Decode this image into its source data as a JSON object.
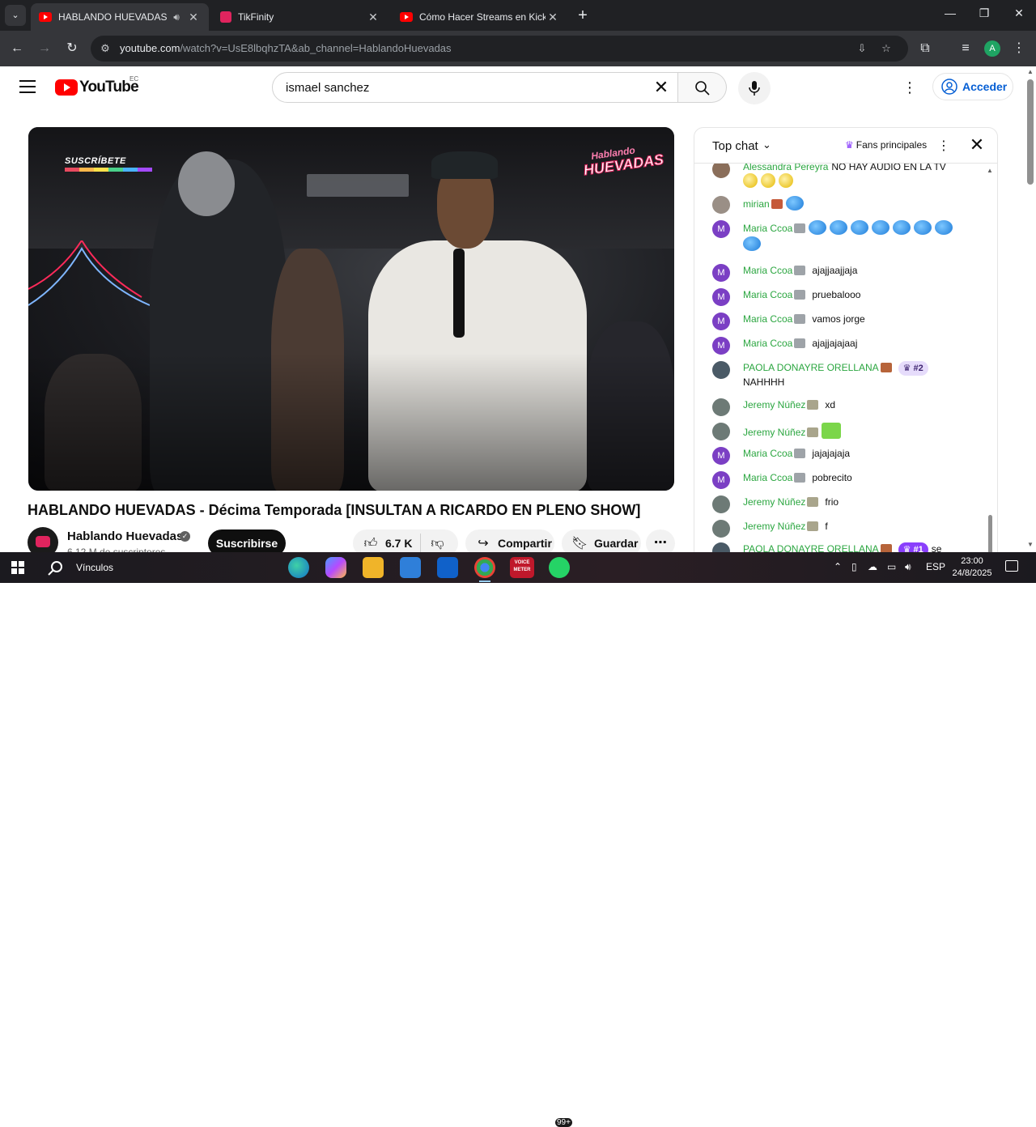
{
  "browser": {
    "tabs": [
      {
        "title": "HABLANDO HUEVADAS - D",
        "icon": "youtube-icon",
        "active": true,
        "audio": true
      },
      {
        "title": "TikFinity",
        "icon": "tikfinity-icon",
        "active": false
      },
      {
        "title": "Cómo Hacer Streams en Kick (C",
        "icon": "youtube-icon",
        "active": false
      }
    ],
    "url_host": "youtube.com",
    "url_path": "/watch?v=UsE8lbqhzTA&ab_channel=HablandoHuevadas",
    "profile_initial": "A"
  },
  "youtube": {
    "logo_text": "YouTube",
    "country_code": "EC",
    "search_value": "ismael sanchez",
    "sign_in_label": "Acceder"
  },
  "video": {
    "overlay_subscribe": "SUSCRÍBETE",
    "overlay_logo_line1": "Hablando",
    "overlay_logo_line2": "HUEVADAS",
    "title": "HABLANDO HUEVADAS - Décima Temporada [INSULTAN A RICARDO EN PLENO SHOW]",
    "channel_name": "Hablando Huevadas",
    "subscribers": "6,12 M de suscriptores",
    "subscribe_label": "Suscribirse",
    "likes": "6.7 K",
    "share_label": "Compartir",
    "save_label": "Guardar"
  },
  "chat": {
    "mode_label": "Top chat",
    "fans_label": "Fans principales",
    "messages": [
      {
        "author": "Alessandra Pereyra",
        "text": "NO HAY AUDIO EN LA TV",
        "avatar": "photo",
        "avatar_color": "#8a6e5a"
      },
      {
        "author": "mirian",
        "text": "",
        "avatar": "photo",
        "avatar_color": "#9a8f86"
      },
      {
        "author": "Maria Ccoa",
        "text": "",
        "avatar": "M",
        "avatar_color": "#7b3fc4"
      },
      {
        "author": "Maria Ccoa",
        "text": "ajajjaajjaja",
        "avatar": "M",
        "avatar_color": "#7b3fc4"
      },
      {
        "author": "Maria Ccoa",
        "text": "pruebalooo",
        "avatar": "M",
        "avatar_color": "#7b3fc4"
      },
      {
        "author": "Maria Ccoa",
        "text": "vamos jorge",
        "avatar": "M",
        "avatar_color": "#7b3fc4"
      },
      {
        "author": "Maria Ccoa",
        "text": "ajajjajajaaj",
        "avatar": "M",
        "avatar_color": "#7b3fc4"
      },
      {
        "author": "PAOLA DONAYRE ORELLANA",
        "text": "NAHHHH",
        "rank": "#2",
        "avatar": "photo",
        "avatar_color": "#4a5a66"
      },
      {
        "author": "Jeremy Núñez",
        "text": "xd",
        "avatar": "photo",
        "avatar_color": "#6d7a76"
      },
      {
        "author": "Jeremy Núñez",
        "text": "",
        "avatar": "photo",
        "avatar_color": "#6d7a76"
      },
      {
        "author": "Maria Ccoa",
        "text": "jajajajaja",
        "avatar": "M",
        "avatar_color": "#7b3fc4"
      },
      {
        "author": "Maria Ccoa",
        "text": "pobrecito",
        "avatar": "M",
        "avatar_color": "#7b3fc4"
      },
      {
        "author": "Jeremy Núñez",
        "text": "frio",
        "avatar": "photo",
        "avatar_color": "#6d7a76"
      },
      {
        "author": "Jeremy Núñez",
        "text": "f",
        "avatar": "photo",
        "avatar_color": "#6d7a76"
      },
      {
        "author": "PAOLA DONAYRE ORELLANA",
        "text": "se",
        "rank": "#1",
        "avatar": "photo",
        "avatar_color": "#4a5a66"
      }
    ]
  },
  "taskbar": {
    "label": "Vínculos",
    "notification_count": "99+",
    "language": "ESP",
    "time": "23:00",
    "date": "24/8/2025",
    "youtube_meter_label": "VOICE METER"
  }
}
